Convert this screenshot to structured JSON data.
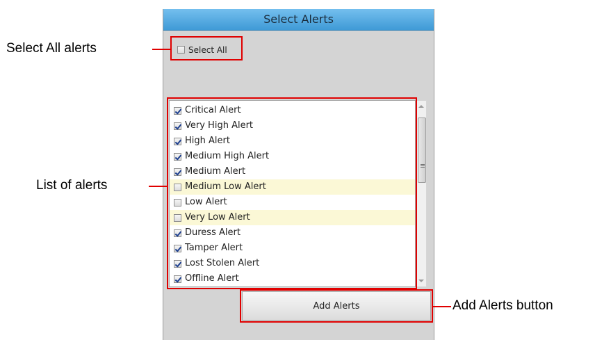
{
  "panel": {
    "title": "Select Alerts",
    "select_all": {
      "label": "Select All",
      "checked": false
    },
    "alerts": [
      {
        "label": "Critical Alert",
        "checked": true,
        "highlighted": false
      },
      {
        "label": "Very High Alert",
        "checked": true,
        "highlighted": false
      },
      {
        "label": "High Alert",
        "checked": true,
        "highlighted": false
      },
      {
        "label": "Medium High Alert",
        "checked": true,
        "highlighted": false
      },
      {
        "label": "Medium Alert",
        "checked": true,
        "highlighted": false
      },
      {
        "label": "Medium Low Alert",
        "checked": false,
        "highlighted": true
      },
      {
        "label": "Low Alert",
        "checked": false,
        "highlighted": false
      },
      {
        "label": "Very Low Alert",
        "checked": false,
        "highlighted": true
      },
      {
        "label": "Duress Alert",
        "checked": true,
        "highlighted": false
      },
      {
        "label": "Tamper Alert",
        "checked": true,
        "highlighted": false
      },
      {
        "label": "Lost Stolen Alert",
        "checked": true,
        "highlighted": false
      },
      {
        "label": "Offline Alert",
        "checked": true,
        "highlighted": false
      }
    ],
    "add_button_label": "Add Alerts"
  },
  "callouts": {
    "select_all": "Select All alerts",
    "list": "List of alerts",
    "add_button": "Add Alerts button"
  },
  "colors": {
    "header": "#4aa3dd",
    "annotation": "#e00000",
    "highlight_row": "#fbf8d6"
  },
  "icons": [
    "checkbox-icon",
    "scroll-up-arrow-icon",
    "scroll-down-arrow-icon",
    "scroll-grip-icon"
  ]
}
